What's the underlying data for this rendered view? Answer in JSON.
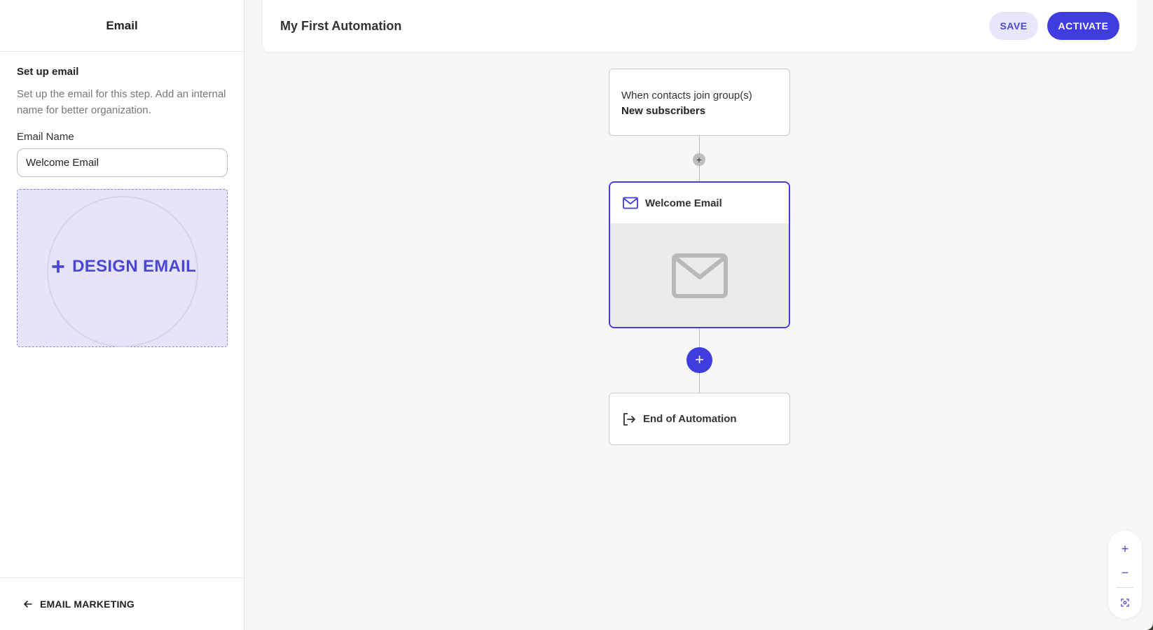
{
  "sidebar": {
    "title": "Email",
    "section_title": "Set up email",
    "section_description": "Set up the email for this step. Add an internal name for better organization.",
    "email_name_label": "Email Name",
    "email_name_value": "Welcome Email",
    "design_button_label": "DESIGN EMAIL",
    "footer_link_label": "EMAIL MARKETING"
  },
  "header": {
    "title": "My First Automation",
    "save_label": "SAVE",
    "activate_label": "ACTIVATE"
  },
  "flow": {
    "trigger": {
      "line1": "When contacts join group(s)",
      "line2": "New subscribers"
    },
    "email_step": {
      "title": "Welcome Email",
      "icon": "mail-icon"
    },
    "end": {
      "title": "End of Automation",
      "icon": "exit-icon"
    }
  },
  "zoom": {
    "zoom_in": "+",
    "zoom_out": "−"
  },
  "colors": {
    "accent": "#3f3ce0",
    "accent_light": "#e7e6fb",
    "design_box_bg": "#e6e4fb"
  }
}
